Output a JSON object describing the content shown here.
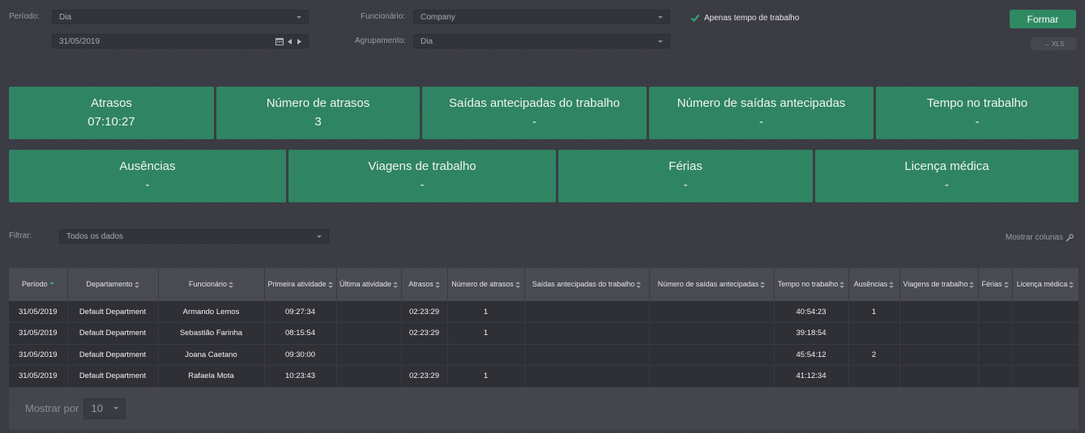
{
  "filters": {
    "periodo_label": "Período:",
    "periodo_value": "Dia",
    "date_value": "31/05/2019",
    "funcionario_label": "Funcionário:",
    "funcionario_value": "Company",
    "agrupamento_label": "Agrupamento:",
    "agrupamento_value": "Dia",
    "apenas_label": "Apenas tempo de trabalho",
    "formar_label": "Formar",
    "xls_label": "→ XLS"
  },
  "cards_row1": [
    {
      "title": "Atrasos",
      "value": "07:10:27"
    },
    {
      "title": "Número de atrasos",
      "value": "3"
    },
    {
      "title": "Saídas antecipadas do trabalho",
      "value": "-"
    },
    {
      "title": "Número de saídas antecipadas",
      "value": "-"
    },
    {
      "title": "Tempo no trabalho",
      "value": "-"
    }
  ],
  "cards_row2": [
    {
      "title": "Ausências",
      "value": "-"
    },
    {
      "title": "Viagens de trabalho",
      "value": "-"
    },
    {
      "title": "Férias",
      "value": "-"
    },
    {
      "title": "Licença médica",
      "value": "-"
    }
  ],
  "filter_bar": {
    "filtrar_label": "Filtrar:",
    "filtrar_value": "Todos os dados",
    "mostrar_colunas": "Mostrar colunas"
  },
  "table": {
    "headers": [
      "Período",
      "Departamento",
      "Funcionário",
      "Primeira atividade",
      "Última atividade",
      "Atrasos",
      "Número de atrasos",
      "Saídas antecipadas do trabalho",
      "Número de saídas antecipadas",
      "Tempo no trabalho",
      "Ausências",
      "Viagens de trabalho",
      "Férias",
      "Licença médica"
    ],
    "rows": [
      [
        "31/05/2019",
        "Default Department",
        "Armando Lemos",
        "09:27:34",
        "",
        "02:23:29",
        "1",
        "",
        "",
        "40:54:23",
        "1",
        "",
        "",
        ""
      ],
      [
        "31/05/2019",
        "Default Department",
        "Sebastião Farinha",
        "08:15:54",
        "",
        "02:23:29",
        "1",
        "",
        "",
        "39:18:54",
        "",
        "",
        "",
        ""
      ],
      [
        "31/05/2019",
        "Default Department",
        "Joana Caetano",
        "09:30:00",
        "",
        "",
        "",
        "",
        "",
        "45:54:12",
        "2",
        "",
        "",
        ""
      ],
      [
        "31/05/2019",
        "Default Department",
        "Rafaela Mota",
        "10:23:43",
        "",
        "02:23:29",
        "1",
        "",
        "",
        "41:12:34",
        "",
        "",
        "",
        ""
      ]
    ]
  },
  "pager": {
    "mostrar_por": "Mostrar por",
    "page_size": "10"
  },
  "colors": {
    "accent": "#2f8463",
    "button": "#2f8a63",
    "background": "#3b3b44"
  }
}
